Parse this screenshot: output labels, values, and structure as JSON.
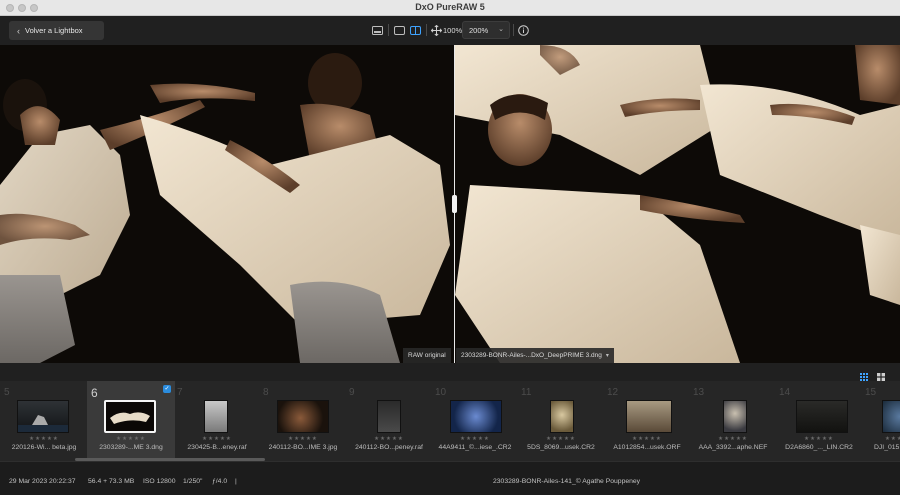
{
  "app": {
    "title": "DxO PureRAW 5"
  },
  "toolbar": {
    "back_label": "Volver a Lightbox",
    "zoom_fit_label": "100%",
    "zoom_value": "200%"
  },
  "viewer": {
    "label_left": "RAW original",
    "label_right": "2303289-BONR-Ailes-...DxO_DeepPRIME 3.dng"
  },
  "filmstrip": {
    "items": [
      {
        "num": "5",
        "name": "220126-Wi... beta.jpg",
        "stars": "★★★★★",
        "selected": false
      },
      {
        "num": "6",
        "name": "2303289-...ME 3.dng",
        "stars": "★★★★★",
        "selected": true
      },
      {
        "num": "7",
        "name": "230425-B...eney.raf",
        "stars": "★★★★★",
        "selected": false
      },
      {
        "num": "8",
        "name": "240112-BO...IME 3.jpg",
        "stars": "★★★★★",
        "selected": false
      },
      {
        "num": "9",
        "name": "240112-BO...peney.raf",
        "stars": "★★★★★",
        "selected": false
      },
      {
        "num": "10",
        "name": "44A9411_©...iese_.CR2",
        "stars": "★★★★★",
        "selected": false
      },
      {
        "num": "11",
        "name": "5DS_8069...usek.CR2",
        "stars": "★★★★★",
        "selected": false
      },
      {
        "num": "12",
        "name": "A1012854...usek.ORF",
        "stars": "★★★★★",
        "selected": false
      },
      {
        "num": "13",
        "name": "AAA_3392...aphe.NEF",
        "stars": "★★★★★",
        "selected": false
      },
      {
        "num": "14",
        "name": "D2A6860_..._LIN.CR2",
        "stars": "★★★★★",
        "selected": false
      },
      {
        "num": "15",
        "name": "DJI_015",
        "stars": "★★★★★",
        "selected": false
      }
    ]
  },
  "status": {
    "date": "29 Mar 2023 20:22:37",
    "size": "56.4 + 73.3 MB",
    "iso": "ISO 12800",
    "shutter": "1/250\"",
    "aperture": "ƒ/4.0",
    "divider": "|",
    "caption": "2303289-BONR-Ailes-141_© Agathe Pouppeney"
  },
  "colors": {
    "accent": "#2b8cdd",
    "background": "#1b1b1b"
  }
}
